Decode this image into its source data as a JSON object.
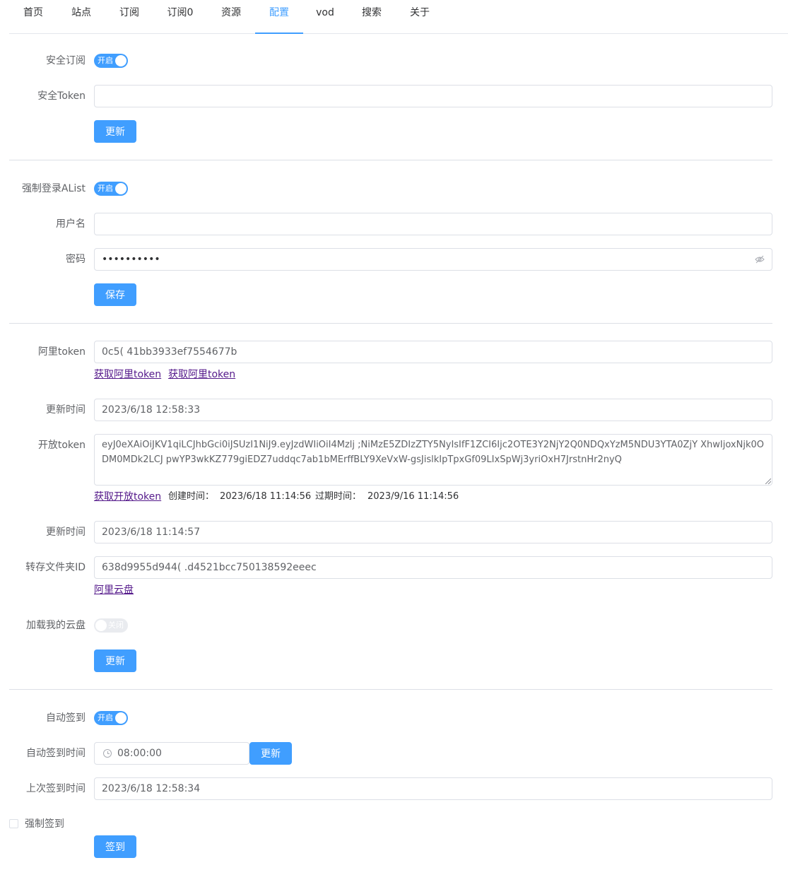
{
  "nav": {
    "items": [
      {
        "label": "首页"
      },
      {
        "label": "站点"
      },
      {
        "label": "订阅"
      },
      {
        "label": "订阅0"
      },
      {
        "label": "资源"
      },
      {
        "label": "配置"
      },
      {
        "label": "vod"
      },
      {
        "label": "搜索"
      },
      {
        "label": "关于"
      }
    ],
    "active": "配置"
  },
  "secure": {
    "switch_label": "安全订阅",
    "switch_text": "开启",
    "switch_on": true,
    "token_label": "安全Token",
    "token_value": "",
    "update_button": "更新"
  },
  "alist": {
    "switch_label": "强制登录AList",
    "switch_text": "开启",
    "switch_on": true,
    "username_label": "用户名",
    "username_value": "",
    "password_label": "密码",
    "password_value": "••••••••••",
    "save_button": "保存"
  },
  "aliyun": {
    "token_label": "阿里token",
    "token_value": "0c5(                      41bb3933ef7554677b",
    "get_token_link_1": "获取阿里token",
    "get_token_link_2": "获取阿里token",
    "token_update_label": "更新时间",
    "token_update_value": "2023/6/18 12:58:33",
    "open_token_label": "开放token",
    "open_token_value": "eyJ0eXAiOiJKV1qiLCJhbGci0iJSUzI1NiJ9.eyJzdWIiOiI4Mzlj                                         ;NiMzE5ZDIzZTY5NyIsIfF1ZCI6Ijc2OTE3Y2NjY2Q0NDQxYzM5NDU3YTA0ZjY                                   XhwIjoxNjk0ODM0MDk2LCJ                              pwYP3wkKZ779giEDZ7uddqc7ab1bMErffBLY9XeVxW-gsJislkIpTpxGf09LIxSpWj3yriOxH7JrstnHr2nyQ",
    "get_open_token_link": "获取开放token",
    "created_label": "创建时间：",
    "created_value": "2023/6/18 11:14:56",
    "expires_label": "过期时间：",
    "expires_value": "2023/9/16 11:14:56",
    "open_update_label": "更新时间",
    "open_update_value": "2023/6/18 11:14:57",
    "folder_label": "转存文件夹ID",
    "folder_value": "638d9955d944(          .d4521bcc750138592eeec",
    "drive_link": "阿里云盘",
    "load_drive_label": "加载我的云盘",
    "load_drive_text": "关闭",
    "load_drive_on": false,
    "update_button": "更新"
  },
  "checkin": {
    "switch_label": "自动签到",
    "switch_text": "开启",
    "switch_on": true,
    "time_label": "自动签到时间",
    "time_value": "08:00:00",
    "time_update_button": "更新",
    "last_label": "上次签到时间",
    "last_value": "2023/6/18 12:58:34",
    "force_label": "强制签到",
    "force_checked": false,
    "checkin_button": "签到"
  }
}
